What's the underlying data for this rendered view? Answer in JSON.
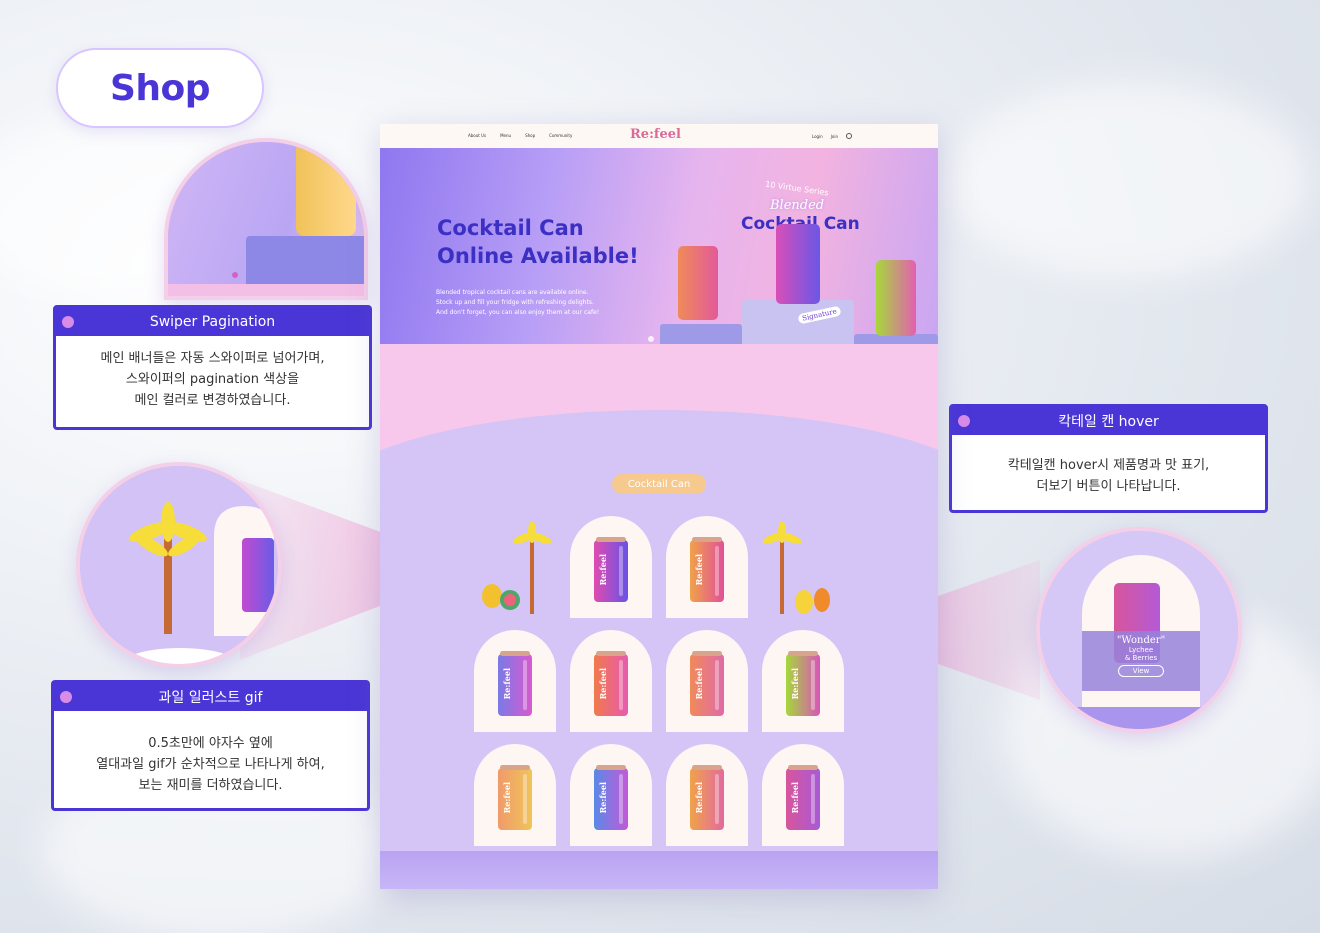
{
  "title": "Shop",
  "annotations": {
    "swiper": {
      "title": "Swiper Pagination",
      "lines": [
        "메인 배너들은 자동 스와이퍼로 넘어가며,",
        "스와이퍼의 pagination 색상을",
        "메인 컬러로 변경하였습니다."
      ]
    },
    "fruit": {
      "title": "과일 일러스트 gif",
      "lines": [
        "0.5초만에 야자수 옆에",
        "열대과일 gif가 순차적으로 나타나게 하여,",
        "보는 재미를 더하였습니다."
      ]
    },
    "cocktail": {
      "title": "칵테일 캔 hover",
      "lines": [
        "칵테일캔 hover시 제품명과 맛 표기,",
        "더보기 버튼이 나타납니다."
      ]
    }
  },
  "site": {
    "nav": {
      "items": [
        "About Us",
        "Menu",
        "Shop",
        "Community"
      ],
      "logo": "Re:feel",
      "login": "Login",
      "join": "Join"
    },
    "hero": {
      "title_line1": "Cocktail Can",
      "title_line2": "Online Available!",
      "desc1": "Blended tropical cocktail cans are available online.",
      "desc2": "Stock up and fill your fridge with refreshing delights.",
      "desc3": "And don't forget, you can also enjoy them at our cafe!",
      "series": "10 Virtue Series",
      "blended": "Blended",
      "cocktail_can": "Cocktail Can",
      "signature": "Signature"
    },
    "section_badge": "Cocktail Can",
    "can_brand": "Re:feel",
    "hover": {
      "name": "\"Wonder\"",
      "flavor1": "Lychee",
      "flavor2": "& Berries",
      "button": "View"
    }
  },
  "colors": {
    "accent": "#4a36d6",
    "pink": "#f7c8ec",
    "lavender": "#d4c5f6"
  }
}
